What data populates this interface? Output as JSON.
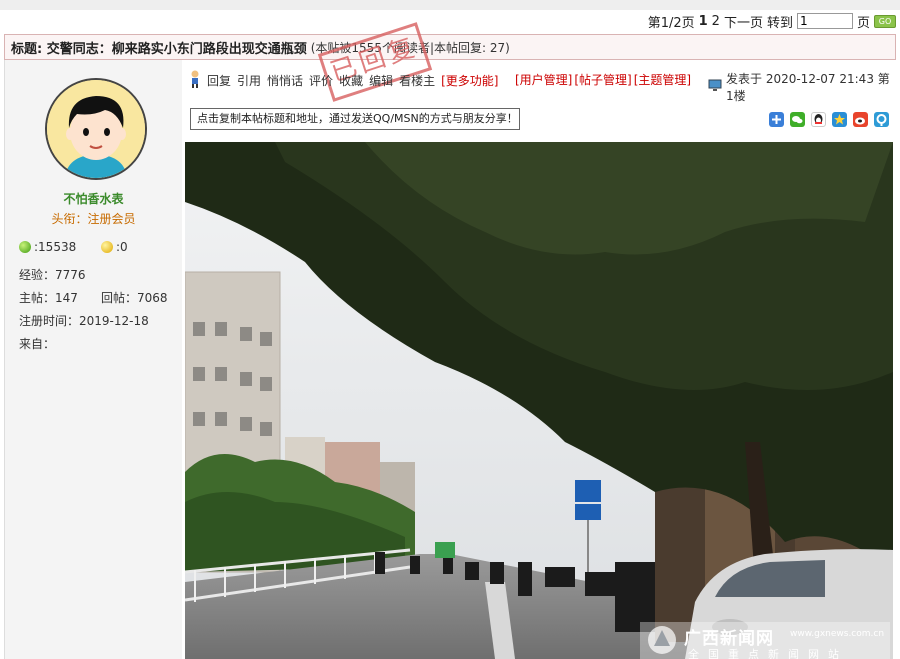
{
  "pager": {
    "page_info": "第1/2页",
    "page1": "1",
    "page2": "2",
    "next": "下一页",
    "goto": "转到",
    "goto_value": "1",
    "page_unit": "页",
    "go": "GO"
  },
  "thread": {
    "title": "标题: 交警同志：柳来路实小东门路段出现交通瓶颈",
    "meta": "(本贴被1555个阅读者|本帖回复: 27)",
    "stamp": "已回复"
  },
  "user": {
    "name": "不怕香水表",
    "rank": "头衔：注册会员",
    "green_points": "15538",
    "yellow_points": "0",
    "exp": "经验：7776",
    "posts": "主帖：147",
    "replies": "回帖：7068",
    "reg": "注册时间：2019-12-18",
    "from": "来自："
  },
  "actions": [
    "回复",
    "引用",
    "悄悄话",
    "评价",
    "收藏",
    "编辑",
    "看楼主"
  ],
  "more": "[更多功能]",
  "manage": [
    "[用户管理]",
    "[帖子管理]",
    "[主题管理]"
  ],
  "posted": "发表于 2020-12-07 21:43 第1楼",
  "share_text": "点击复制本帖标题和地址，通过发送QQ/MSN的方式与朋友分享！",
  "watermark": {
    "site": "广西新闻网",
    "domain": "www.gxnews.com.cn",
    "sub": "全国重点新闻网站"
  },
  "colors": {
    "accent_red": "#cc0000",
    "name_green": "#3a8a2a"
  }
}
